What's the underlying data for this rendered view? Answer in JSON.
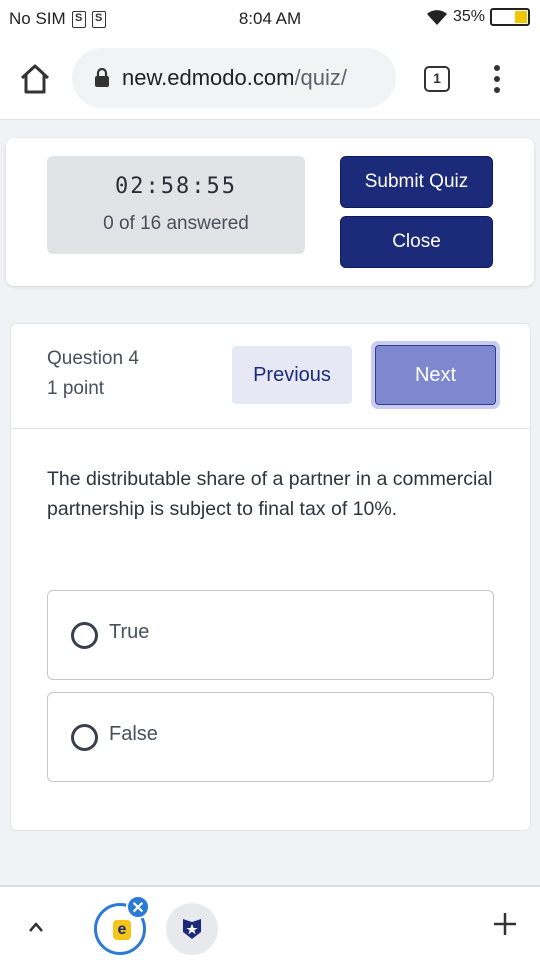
{
  "status_bar": {
    "carrier": "No SIM",
    "sim_icon_1": "S",
    "sim_icon_2": "S",
    "time": "8:04 AM",
    "battery": "35%",
    "icons": [
      "wifi-icon",
      "battery-icon"
    ]
  },
  "browser": {
    "url_host": "new.edmodo.com",
    "url_path": "/quiz/",
    "tab_count": "1",
    "icons": [
      "home-icon",
      "lock-icon",
      "tabs-icon",
      "menu-icon"
    ]
  },
  "quiz_header": {
    "timer": "02:58:55",
    "answered": "0 of 16 answered",
    "submit_label": "Submit Quiz",
    "close_label": "Close"
  },
  "question": {
    "number_label": "Question 4",
    "points_label": "1 point",
    "prev_label": "Previous",
    "next_label": "Next",
    "text": "The distributable share of a partner in a commercial partnership is subject to final tax of 10%.",
    "options": [
      {
        "label": "True"
      },
      {
        "label": "False"
      }
    ]
  },
  "bottom_bar": {
    "edmodo_badge": "e",
    "close_badge": "✕",
    "icons": [
      "chevron-up-icon",
      "edmodo-tab-icon",
      "shield-star-icon",
      "plus-icon"
    ]
  },
  "colors": {
    "primary": "#1c2a7a",
    "next_button": "#7f88cf",
    "timer_bg": "#e2e3e7",
    "accent_blue": "#2a7ad6",
    "battery_fill": "#f3c400"
  }
}
